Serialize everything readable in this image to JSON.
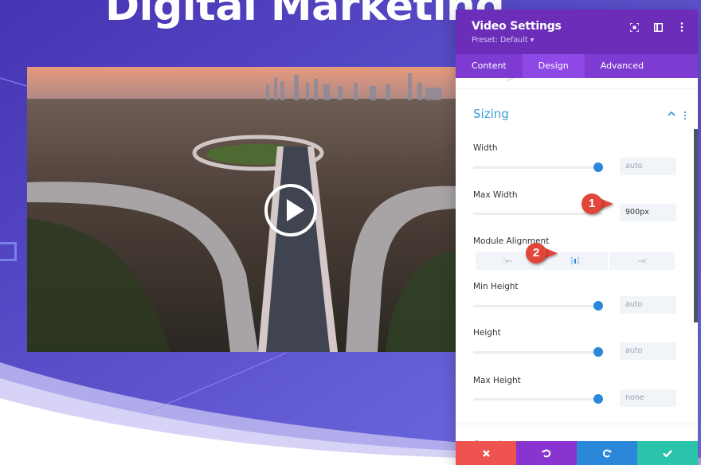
{
  "page": {
    "hero_title": "Digital Marketing",
    "colors": {
      "hero_gradient_start": "#4a36b8",
      "hero_gradient_end": "#6b63e0",
      "panel_header": "#6c2eb9",
      "tabs_bg": "#7d3bd1",
      "active_tab": "#8f49e6",
      "section_accent": "#3d9bd7",
      "slider_thumb": "#2b87da",
      "cancel": "#ef5350",
      "undo": "#8a34d0",
      "redo": "#2b87da",
      "save": "#29c4a9",
      "callout": "#e2463a"
    }
  },
  "video": {
    "play_icon": "play-circle-icon"
  },
  "panel": {
    "title": "Video Settings",
    "preset": "Preset: Default ▾",
    "header_icons": [
      "fullscreen-icon",
      "split-view-icon",
      "more-options-icon"
    ],
    "tabs": [
      {
        "label": "Content",
        "active": false
      },
      {
        "label": "Design",
        "active": true
      },
      {
        "label": "Advanced",
        "active": false
      }
    ],
    "section": {
      "title": "Sizing",
      "expanded": true,
      "fields": [
        {
          "label": "Width",
          "value": "auto",
          "slider_percent": 100
        },
        {
          "label": "Max Width",
          "value": "900px",
          "slider_percent": 100
        },
        {
          "label": "Module Alignment",
          "options": [
            "left",
            "center",
            "right"
          ],
          "selected": "center"
        },
        {
          "label": "Min Height",
          "value": "auto",
          "slider_percent": 100
        },
        {
          "label": "Height",
          "value": "auto",
          "slider_percent": 100
        },
        {
          "label": "Max Height",
          "value": "none",
          "slider_percent": 100
        }
      ]
    },
    "collapsed_section": "Spacing",
    "footer": {
      "cancel": "cancel-icon",
      "undo": "undo-icon",
      "redo": "redo-icon",
      "save": "save-check-icon"
    }
  },
  "callouts": [
    {
      "number": "1"
    },
    {
      "number": "2"
    }
  ]
}
